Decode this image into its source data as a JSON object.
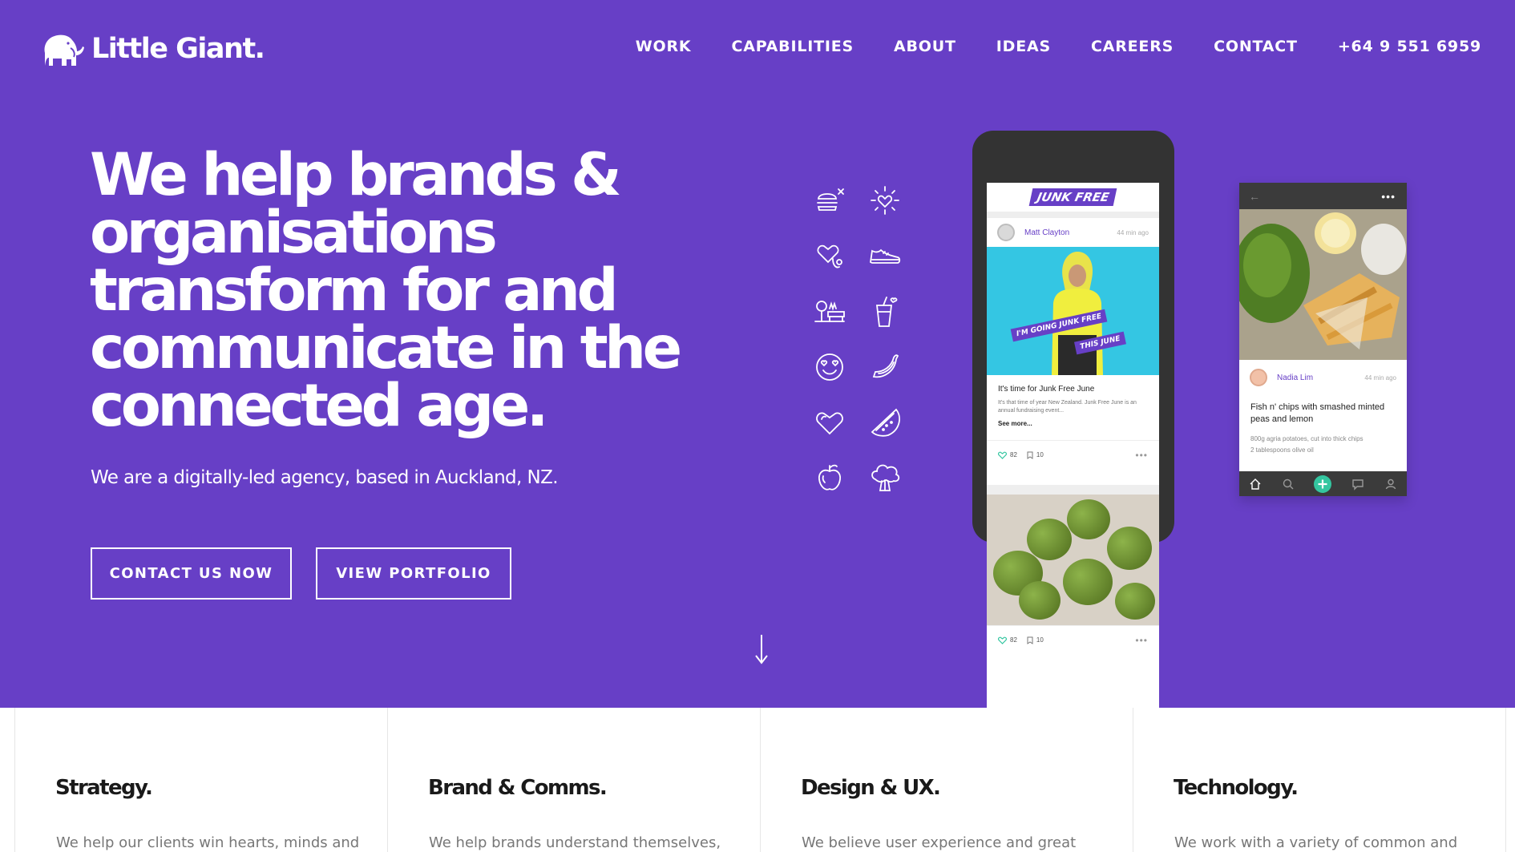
{
  "brand": {
    "name": "Little Giant.",
    "logo_icon": "mammoth-icon"
  },
  "nav": {
    "items": [
      "WORK",
      "CAPABILITIES",
      "ABOUT",
      "IDEAS",
      "CAREERS",
      "CONTACT"
    ],
    "phone": "+64 9 551 6959"
  },
  "hero": {
    "headline_lines": [
      "We help brands &",
      "organisations",
      "transform for and",
      "communicate in the",
      "connected age."
    ],
    "subline": "We are a digitally-led agency, based in Auckland, NZ.",
    "contact_button": "CONTACT US NOW",
    "portfolio_button": "VIEW PORTFOLIO"
  },
  "icons": [
    "burger-icon",
    "sparkle-heart-icon",
    "stethoscope-heart-icon",
    "sneaker-icon",
    "picnic-icon",
    "drink-icon",
    "heart-eyes-icon",
    "banana-icon",
    "heart-icon",
    "watermelon-icon",
    "apple-icon",
    "broccoli-icon"
  ],
  "phone_app": {
    "logo": "JUNK FREE",
    "post": {
      "author": "Matt Clayton",
      "time": "44 min ago",
      "ribbon_1": "I'M GOING JUNK FREE",
      "ribbon_2": "THIS JUNE",
      "title": "It's time for Junk Free June",
      "text": "It's that time of year New Zealand. Junk Free June is an annual fundraising event...",
      "more": "See more...",
      "likes": "82",
      "comments": "10"
    },
    "post2": {
      "likes": "82",
      "comments": "10"
    }
  },
  "card2": {
    "author": "Nadia Lim",
    "time": "44 min ago",
    "title": "Fish n' chips with smashed minted peas and lemon",
    "line_1": "800g agria potatoes, cut into thick chips",
    "line_2": "2 tablespoons olive oil"
  },
  "services": [
    {
      "title": "Strategy.",
      "text": "We help our clients win hearts, minds and"
    },
    {
      "title": "Brand & Comms.",
      "text": "We help brands understand themselves,"
    },
    {
      "title": "Design & UX.",
      "text": "We believe user experience and great"
    },
    {
      "title": "Technology.",
      "text": "We work with a variety of common and"
    }
  ],
  "colors": {
    "hero_bg": "#673fc6",
    "phone_frame": "#333333",
    "accent_green": "#34c6a0",
    "accent_cyan": "#34c6e3"
  }
}
